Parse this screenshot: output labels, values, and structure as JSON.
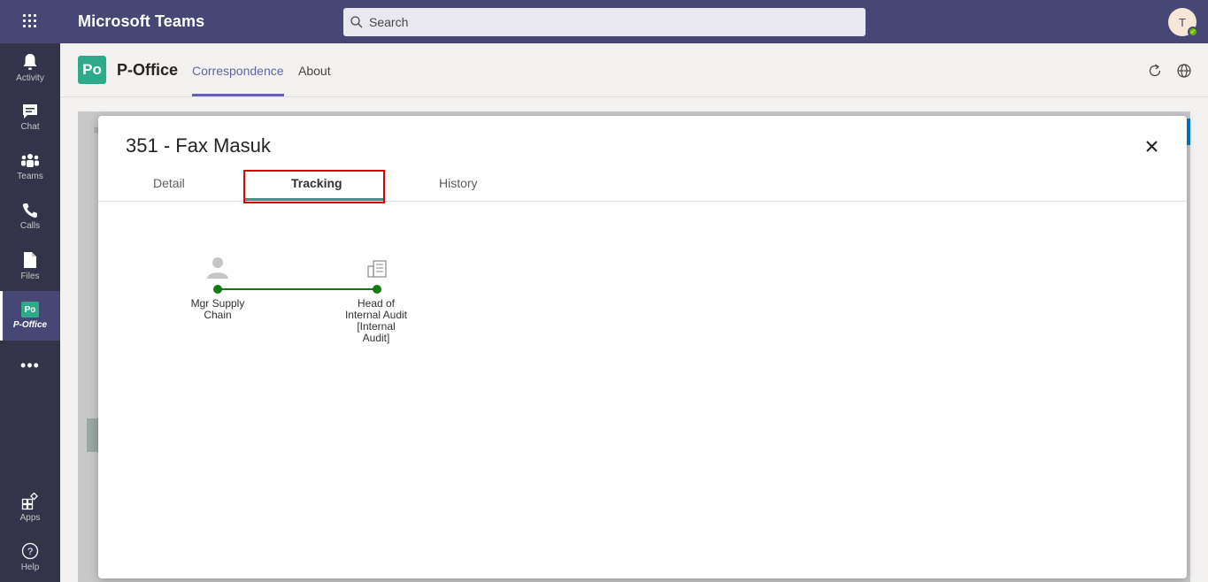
{
  "topbar": {
    "app_title": "Microsoft Teams",
    "search_placeholder": "Search",
    "avatar_initial": "T",
    "colors": {
      "bar": "#464775",
      "status": "#6bb700"
    }
  },
  "rail": {
    "items": [
      {
        "label": "Activity",
        "icon": "bell-icon"
      },
      {
        "label": "Chat",
        "icon": "chat-icon"
      },
      {
        "label": "Teams",
        "icon": "teams-icon"
      },
      {
        "label": "Calls",
        "icon": "phone-icon"
      },
      {
        "label": "Files",
        "icon": "file-icon"
      },
      {
        "label": "P-Office",
        "icon": "p-office-icon",
        "active": true,
        "badge": "Po"
      },
      {
        "label": "Apps",
        "icon": "apps-icon"
      },
      {
        "label": "Help",
        "icon": "help-icon"
      }
    ],
    "more": "•••"
  },
  "app_header": {
    "logo_text": "Po",
    "name": "P-Office",
    "tabs": [
      {
        "label": "Correspondence",
        "active": true
      },
      {
        "label": "About"
      }
    ],
    "icons": [
      "refresh-icon",
      "globe-icon"
    ]
  },
  "backdrop": {
    "menu_glyph": "≡"
  },
  "modal": {
    "title": "351 - Fax Masuk",
    "close_glyph": "✕",
    "tabs": [
      {
        "label": "Detail"
      },
      {
        "label": "Tracking",
        "active": true
      },
      {
        "label": "History"
      }
    ],
    "tracking": {
      "nodes": [
        {
          "label": "Mgr Supply\nChain",
          "icon": "person-icon"
        },
        {
          "label": "Head of\nInternal Audit\n[Internal\nAudit]",
          "icon": "building-icon"
        }
      ],
      "line_color": "#107c10"
    }
  }
}
